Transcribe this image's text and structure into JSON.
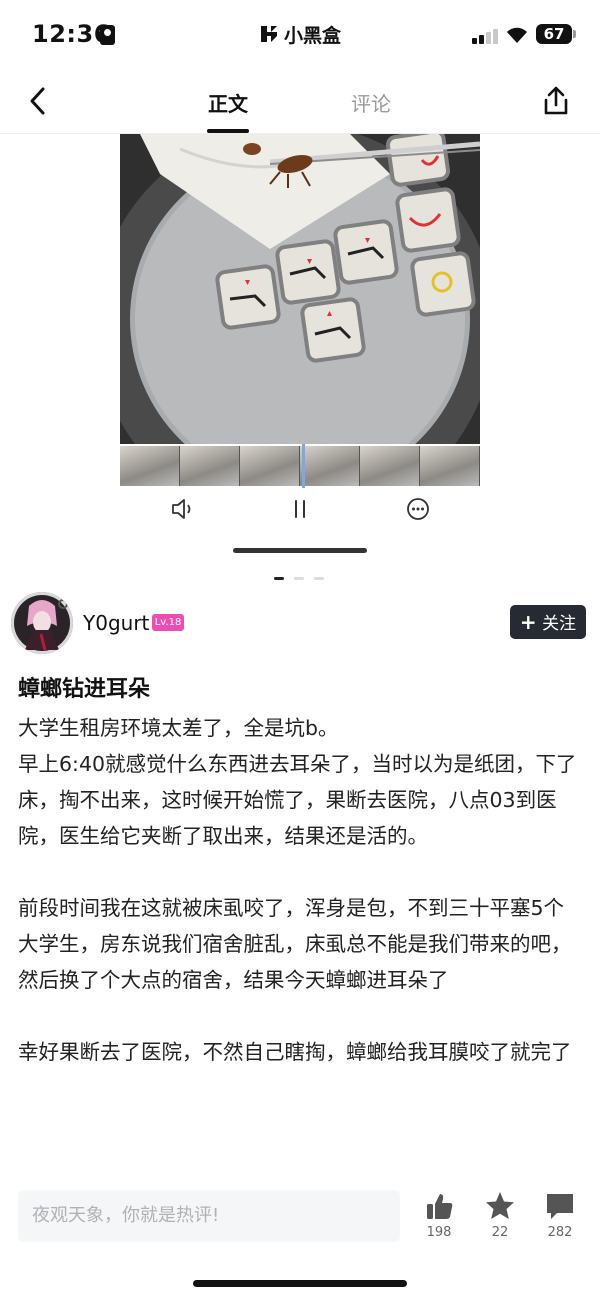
{
  "status_bar": {
    "time": "12:36",
    "app_name": "小黑盒",
    "battery": "67"
  },
  "nav": {
    "back_icon": "chevron-left-icon",
    "tabs": [
      {
        "label": "正文",
        "active": true
      },
      {
        "label": "评论",
        "active": false
      }
    ],
    "share_icon": "share-icon"
  },
  "media": {
    "controls": [
      "speaker-icon",
      "pause-icon",
      "more-icon"
    ],
    "pages": 3,
    "current_page": 1
  },
  "author": {
    "name": "Y0gurt",
    "level": "Lv.18",
    "follow_label": "关注"
  },
  "post": {
    "title": "蟑螂钻进耳朵",
    "paragraphs": [
      "大学生租房环境太差了，全是坑b。",
      "早上6:40就感觉什么东西进去耳朵了，当时以为是纸团，下了床，掏不出来，这时候开始慌了，果断去医院，八点03到医院，医生给它夹断了取出来，结果还是活的。",
      "",
      "前段时间我在这就被床虱咬了，浑身是包，不到三十平塞5个大学生，房东说我们宿舍脏乱，床虱总不能是我们带来的吧，然后换了个大点的宿舍，结果今天蟑螂进耳朵了",
      "",
      "幸好果断去了医院，不然自己瞎掏，蟑螂给我耳膜咬了就完了"
    ]
  },
  "comment_bar": {
    "placeholder": "夜观天象，你就是热评!",
    "likes": "198",
    "favorites": "22",
    "comments": "282"
  },
  "colors": {
    "level_badge": "#ea4eb4",
    "follow_button": "#262a33"
  }
}
